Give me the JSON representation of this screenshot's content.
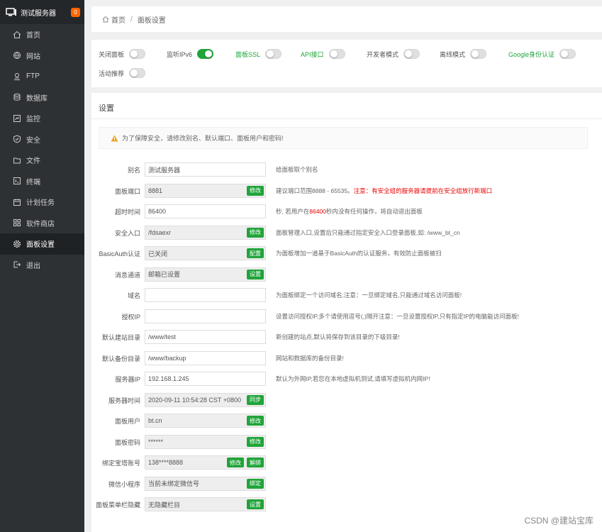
{
  "sidebar": {
    "brand": "测试服务器",
    "badge": "0",
    "items": [
      {
        "label": "首页",
        "icon": "home-icon"
      },
      {
        "label": "网站",
        "icon": "globe-icon"
      },
      {
        "label": "FTP",
        "icon": "ftp-icon"
      },
      {
        "label": "数据库",
        "icon": "database-icon"
      },
      {
        "label": "监控",
        "icon": "monitor-icon"
      },
      {
        "label": "安全",
        "icon": "shield-icon"
      },
      {
        "label": "文件",
        "icon": "folder-icon"
      },
      {
        "label": "终端",
        "icon": "terminal-icon"
      },
      {
        "label": "计划任务",
        "icon": "calendar-icon"
      },
      {
        "label": "软件商店",
        "icon": "grid-icon"
      },
      {
        "label": "面板设置",
        "icon": "gear-icon",
        "active": true
      },
      {
        "label": "退出",
        "icon": "logout-icon"
      }
    ]
  },
  "breadcrumb": {
    "home": "首页",
    "separator": "/",
    "current": "面板设置"
  },
  "toggles": [
    {
      "label": "关闭面板",
      "on": false,
      "green": false
    },
    {
      "label": "监听IPv6",
      "on": true,
      "green": false
    },
    {
      "label": "面板SSL",
      "on": false,
      "green": true
    },
    {
      "label": "API接口",
      "on": false,
      "green": true
    },
    {
      "label": "开发者模式",
      "on": false,
      "green": false
    },
    {
      "label": "离线模式",
      "on": false,
      "green": false
    },
    {
      "label": "Google身份认证",
      "on": false,
      "green": true
    },
    {
      "label": "活动推荐",
      "on": false,
      "green": false
    }
  ],
  "settings": {
    "title": "设置",
    "notice": "为了保障安全，请修改别名、默认端口、面板用户和密码!",
    "rows": [
      {
        "label": "别名",
        "value": "测试服务器",
        "readonly": false,
        "buttons": [],
        "hint": "给面板取个别名"
      },
      {
        "label": "面板端口",
        "value": "8881",
        "readonly": true,
        "buttons": [
          "修改"
        ],
        "hint": "建议端口范围8888 - 65535。",
        "hint_red": "注意：有安全组的服务器请提前在安全组放行新端口"
      },
      {
        "label": "超时时间",
        "value": "86400",
        "readonly": false,
        "buttons": [],
        "hint": "秒, 若用户在",
        "hint_red": "86400",
        "hint_tail": "秒内没有任何操作，将自动退出面板"
      },
      {
        "label": "安全入口",
        "value": "/fdsaexr",
        "readonly": true,
        "buttons": [
          "修改"
        ],
        "hint": "面板管理入口,设置后只能通过指定安全入口登录面板,如: /www_bt_cn"
      },
      {
        "label": "BasicAuth认证",
        "value": "已关闭",
        "readonly": true,
        "buttons": [
          "配置"
        ],
        "hint": "为面板增加一道基于BasicAuth的认证服务，有效防止面板被扫"
      },
      {
        "label": "消息通道",
        "value": "邮箱已设置",
        "readonly": true,
        "buttons": [
          "设置"
        ],
        "hint": ""
      },
      {
        "label": "域名",
        "value": "",
        "readonly": false,
        "buttons": [],
        "hint": "为面板绑定一个访问域名;注意：一旦绑定域名,只能通过域名访问面板!"
      },
      {
        "label": "授权IP",
        "value": "",
        "readonly": false,
        "buttons": [],
        "hint": "设置访问授权IP,多个请使用逗号(,)隔开注意：一旦设置授权IP,只有指定IP的电脑能访问面板!"
      },
      {
        "label": "默认建站目录",
        "value": "/www/test",
        "readonly": false,
        "buttons": [],
        "hint": "新创建的站点,默认将保存到该目录的下级目录!"
      },
      {
        "label": "默认备份目录",
        "value": "/www/backup",
        "readonly": false,
        "buttons": [],
        "hint": "网站和数据库的备份目录!"
      },
      {
        "label": "服务器IP",
        "value": "192.168.1.245",
        "readonly": false,
        "buttons": [],
        "hint": "默认为外网IP,若您在本地虚拟机测试,请填写虚拟机内网IP!"
      },
      {
        "label": "服务器时间",
        "value": "2020-09-11 10:54:28 CST +0800",
        "readonly": true,
        "buttons": [
          "同步"
        ],
        "hint": ""
      },
      {
        "label": "面板用户",
        "value": "bt.cn",
        "readonly": true,
        "buttons": [
          "修改"
        ],
        "hint": ""
      },
      {
        "label": "面板密码",
        "value": "******",
        "readonly": true,
        "buttons": [
          "修改"
        ],
        "hint": ""
      },
      {
        "label": "绑定宝塔账号",
        "value": "138****8888",
        "readonly": true,
        "buttons": [
          "修改",
          "解绑"
        ],
        "hint": ""
      },
      {
        "label": "微信小程序",
        "value": "当前未绑定微信号",
        "readonly": true,
        "buttons": [
          "绑定"
        ],
        "hint": ""
      },
      {
        "label": "面板菜单栏隐藏",
        "value": "无隐藏栏目",
        "readonly": true,
        "buttons": [
          "设置"
        ],
        "hint": ""
      }
    ]
  },
  "watermark": "CSDN @建站宝库"
}
